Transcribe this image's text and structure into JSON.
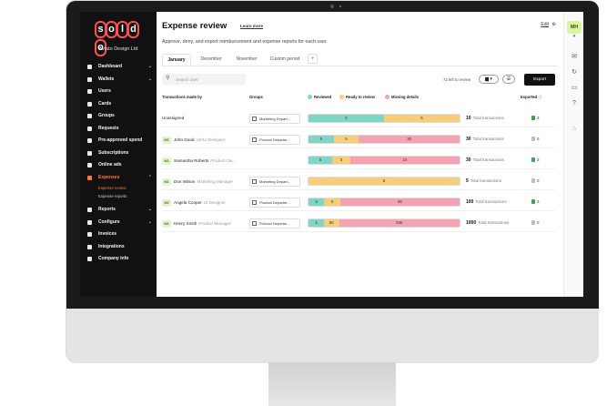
{
  "sidebar": {
    "logo": "soldo",
    "company": "Aviato Design Ltd",
    "items": [
      {
        "label": "Dashboard",
        "chevron": true
      },
      {
        "label": "Wallets",
        "chevron": true
      },
      {
        "label": "Users",
        "chevron": false
      },
      {
        "label": "Cards",
        "chevron": false
      },
      {
        "label": "Groups",
        "chevron": false
      },
      {
        "label": "Requests",
        "chevron": false
      },
      {
        "label": "Pre-approved spend",
        "chevron": false
      },
      {
        "label": "Subscriptions",
        "chevron": false
      },
      {
        "label": "Online ads",
        "chevron": false
      },
      {
        "label": "Expenses",
        "chevron": true,
        "active": true
      }
    ],
    "sub_items": [
      {
        "label": "Expense review",
        "active": true
      },
      {
        "label": "Expense reports",
        "active": false
      }
    ],
    "items_after": [
      {
        "label": "Reports",
        "chevron": true
      },
      {
        "label": "Configure",
        "chevron": true
      },
      {
        "label": "Invoices",
        "chevron": false
      },
      {
        "label": "Integrations",
        "chevron": false
      },
      {
        "label": "Company info",
        "chevron": false
      }
    ]
  },
  "header": {
    "title": "Expense review",
    "learn_more": "Learn more",
    "edit": "Edit",
    "subtitle": "Approve, deny, and export reimbursement and expense reports for each user."
  },
  "tabs": [
    {
      "label": "January",
      "active": true
    },
    {
      "label": "December",
      "active": false
    },
    {
      "label": "November",
      "active": false
    },
    {
      "label": "Custom period",
      "active": false
    }
  ],
  "tab_add": "+",
  "toolbar": {
    "search_placeholder": "Search user",
    "left_to_review": "72 left to review",
    "export_label": "Export"
  },
  "table": {
    "headers": {
      "user": "Transactions made by",
      "groups": "Groups",
      "reviewed": "Reviewed",
      "ready": "Ready to review",
      "missing": "Missing details",
      "exported": "Exported"
    },
    "colors": {
      "reviewed": "#7fd6c6",
      "ready": "#f6cd7b",
      "missing": "#f5a3b3"
    },
    "rows": [
      {
        "initials": "",
        "name": "Unassigned",
        "role": "",
        "group": "Marketing Depart...",
        "reviewed": 5,
        "ready": 5,
        "missing": 0,
        "total": "10",
        "total_label": "Total transactions",
        "exported": "3",
        "exported_done": true
      },
      {
        "initials": "NS",
        "name": "John Good",
        "role": "UX/UI Designer",
        "group": "Product Departm...",
        "reviewed": 5,
        "ready": 5,
        "missing": 20,
        "total": "30",
        "total_label": "Total transactions",
        "exported": "0",
        "exported_done": false
      },
      {
        "initials": "NS",
        "name": "Samantha Roberts",
        "role": "Product Ow...",
        "group": "",
        "reviewed": 5,
        "ready": 3,
        "missing": 23,
        "total": "30",
        "total_label": "Total transactions",
        "exported": "3",
        "exported_done": true
      },
      {
        "initials": "NS",
        "name": "Don Wilson",
        "role": "Marketing Manager",
        "group": "Marketing Depart...",
        "reviewed": 0,
        "ready": 5,
        "missing": 0,
        "total": "5",
        "total_label": "Total transactions",
        "exported": "0",
        "exported_done": false
      },
      {
        "initials": "NS",
        "name": "Angela Cooper",
        "role": "UI Designer",
        "group": "Product Departm...",
        "reviewed": 5,
        "ready": 5,
        "missing": 90,
        "total": "100",
        "total_label": "Total transactions",
        "exported": "3",
        "exported_done": true
      },
      {
        "initials": "NS",
        "name": "Henry Smith",
        "role": "Product Manager",
        "group": "Product Departm...",
        "reviewed": 4,
        "ready": 50,
        "missing": 946,
        "total": "1000",
        "total_label": "Total transactions",
        "exported": "0",
        "exported_done": false
      }
    ]
  },
  "rail": {
    "avatar": "MH"
  }
}
